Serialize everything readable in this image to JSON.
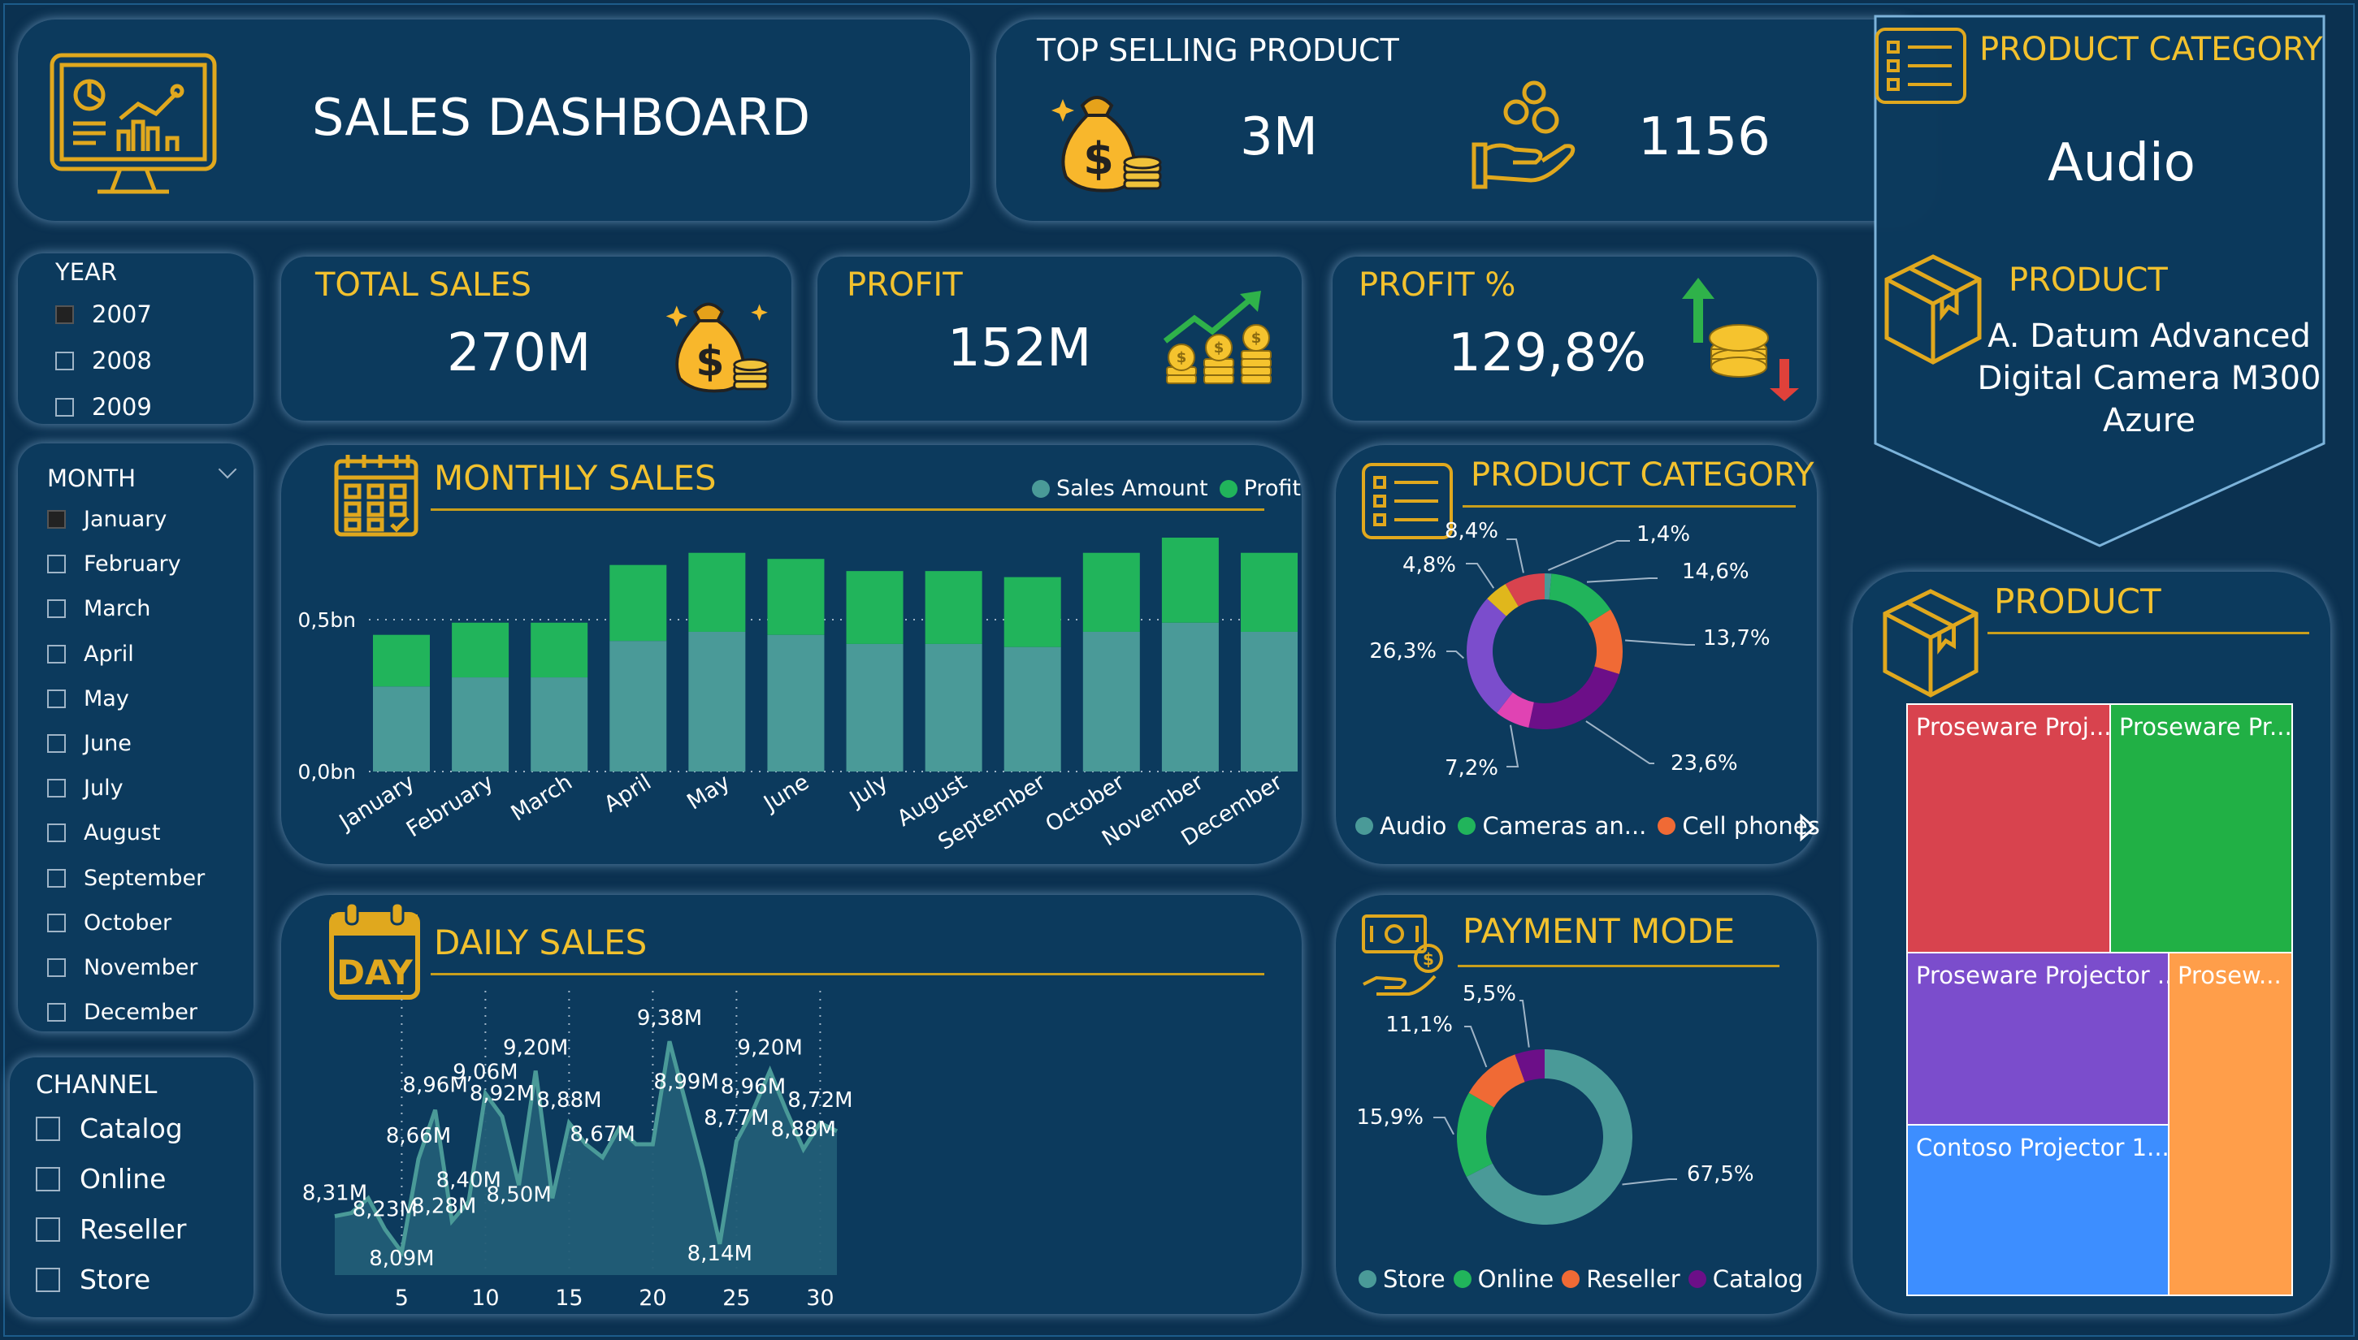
{
  "header": {
    "title": "SALES DASHBOARD"
  },
  "top_selling": {
    "title": "TOP SELLING PRODUCT",
    "sales_value": "3M",
    "quantity_value": "1156"
  },
  "side_category": {
    "title": "PRODUCT CATEGORY",
    "value": "Audio",
    "product_title": "PRODUCT",
    "product_lines": [
      "A. Datum Advanced",
      "Digital Camera M300",
      "Azure"
    ]
  },
  "kpis": {
    "total_sales": {
      "title": "TOTAL SALES",
      "value": "270M"
    },
    "profit": {
      "title": "PROFIT",
      "value": "152M"
    },
    "profit_pct": {
      "title": "PROFIT %",
      "value": "129,8%"
    }
  },
  "slicers": {
    "year": {
      "title": "YEAR",
      "items": [
        {
          "label": "2007",
          "checked": true
        },
        {
          "label": "2008",
          "checked": false
        },
        {
          "label": "2009",
          "checked": false
        }
      ]
    },
    "month": {
      "title": "MONTH",
      "items": [
        {
          "label": "January",
          "checked": true
        },
        {
          "label": "February",
          "checked": false
        },
        {
          "label": "March",
          "checked": false
        },
        {
          "label": "April",
          "checked": false
        },
        {
          "label": "May",
          "checked": false
        },
        {
          "label": "June",
          "checked": false
        },
        {
          "label": "July",
          "checked": false
        },
        {
          "label": "August",
          "checked": false
        },
        {
          "label": "September",
          "checked": false
        },
        {
          "label": "October",
          "checked": false
        },
        {
          "label": "November",
          "checked": false
        },
        {
          "label": "December",
          "checked": false
        }
      ]
    },
    "channel": {
      "title": "CHANNEL",
      "items": [
        {
          "label": "Catalog",
          "checked": false
        },
        {
          "label": "Online",
          "checked": false
        },
        {
          "label": "Reseller",
          "checked": false
        },
        {
          "label": "Store",
          "checked": false
        }
      ]
    }
  },
  "colors": {
    "accent": "#f2c12e",
    "card": "#0c3a5d",
    "background": "#0b3150",
    "teal": "#4a9a98",
    "green": "#21b45b"
  },
  "chart_data": [
    {
      "type": "bar",
      "title": "MONTHLY SALES",
      "stacked": true,
      "categories": [
        "January",
        "February",
        "March",
        "April",
        "May",
        "June",
        "July",
        "August",
        "September",
        "October",
        "November",
        "December"
      ],
      "series": [
        {
          "name": "Sales Amount",
          "color": "#4a9a98",
          "values": [
            0.28,
            0.31,
            0.31,
            0.43,
            0.46,
            0.45,
            0.42,
            0.42,
            0.41,
            0.46,
            0.49,
            0.46
          ]
        },
        {
          "name": "Profit",
          "color": "#21b45b",
          "values": [
            0.17,
            0.18,
            0.18,
            0.25,
            0.26,
            0.25,
            0.24,
            0.24,
            0.23,
            0.26,
            0.28,
            0.26
          ]
        }
      ],
      "y_ticks": [
        "0,0bn",
        "0,5bn"
      ],
      "ylim": [
        0,
        0.7
      ]
    },
    {
      "type": "area",
      "title": "DAILY SALES",
      "x": [
        1,
        2,
        3,
        4,
        5,
        6,
        7,
        8,
        9,
        10,
        11,
        12,
        13,
        14,
        15,
        16,
        17,
        18,
        19,
        20,
        21,
        22,
        23,
        24,
        25,
        26,
        27,
        28,
        29,
        30,
        31
      ],
      "values": [
        8.31,
        8.33,
        8.42,
        8.23,
        8.09,
        8.66,
        8.96,
        8.28,
        8.4,
        9.06,
        8.92,
        8.5,
        9.2,
        8.42,
        8.88,
        8.75,
        8.67,
        8.85,
        8.75,
        8.75,
        9.38,
        8.99,
        8.6,
        8.14,
        8.77,
        8.96,
        9.2,
        8.95,
        8.72,
        8.88,
        8.83
      ],
      "labels": [
        "8,31M",
        "8,23M",
        "8,09M",
        "8,66M",
        "8,96M",
        "8,28M",
        "8,40M",
        "9,06M",
        "8,92M",
        "8,50M",
        "9,20M",
        "8,88M",
        "8,67M",
        "9,38M",
        "8,99M",
        "8,14M",
        "8,77M",
        "8,96M",
        "9,20M",
        "8,88M",
        "8,72M"
      ],
      "x_ticks": [
        "5",
        "10",
        "15",
        "20",
        "25",
        "30"
      ],
      "ylim": [
        7.95,
        9.55
      ]
    },
    {
      "type": "pie",
      "title": "PRODUCT CATEGORY",
      "donut": true,
      "slices": [
        {
          "label": "Audio",
          "value": 1.4,
          "text": "1,4%",
          "color": "#4a9a98"
        },
        {
          "label": "Cameras an...",
          "value": 14.6,
          "text": "14,6%",
          "color": "#21b45b"
        },
        {
          "label": "Cell phones",
          "value": 13.7,
          "text": "13,7%",
          "color": "#f06a35"
        },
        {
          "value": 23.6,
          "text": "23,6%",
          "color": "#6c0f88"
        },
        {
          "value": 7.2,
          "text": "7,2%",
          "color": "#e043b3"
        },
        {
          "value": 26.3,
          "text": "26,3%",
          "color": "#7b4dcc"
        },
        {
          "value": 4.8,
          "text": "4,8%",
          "color": "#e0b71c"
        },
        {
          "value": 8.4,
          "text": "8,4%",
          "color": "#d8434e"
        }
      ],
      "legend": [
        "Audio",
        "Cameras an...",
        "Cell phones"
      ]
    },
    {
      "type": "pie",
      "title": "PAYMENT MODE",
      "donut": true,
      "slices": [
        {
          "label": "Store",
          "value": 67.5,
          "text": "67,5%",
          "color": "#4a9a98"
        },
        {
          "label": "Online",
          "value": 15.9,
          "text": "15,9%",
          "color": "#21b45b"
        },
        {
          "label": "Reseller",
          "value": 11.1,
          "text": "11,1%",
          "color": "#f06a35"
        },
        {
          "label": "Catalog",
          "value": 5.5,
          "text": "5,5%",
          "color": "#6c0f88"
        }
      ],
      "legend": [
        "Store",
        "Online",
        "Reseller",
        "Catalog"
      ]
    },
    {
      "type": "treemap",
      "title": "PRODUCT",
      "tiles": [
        {
          "label": "Proseware Proj...",
          "color": "#d8434e"
        },
        {
          "label": "Proseware Pr...",
          "color": "#21b045"
        },
        {
          "label": "Proseware Projector ...",
          "color": "#7b4dcc"
        },
        {
          "label": "Prosew...",
          "color": "#ff9e4a"
        },
        {
          "label": "Contoso Projector 1...",
          "color": "#3d8eff"
        }
      ]
    }
  ]
}
